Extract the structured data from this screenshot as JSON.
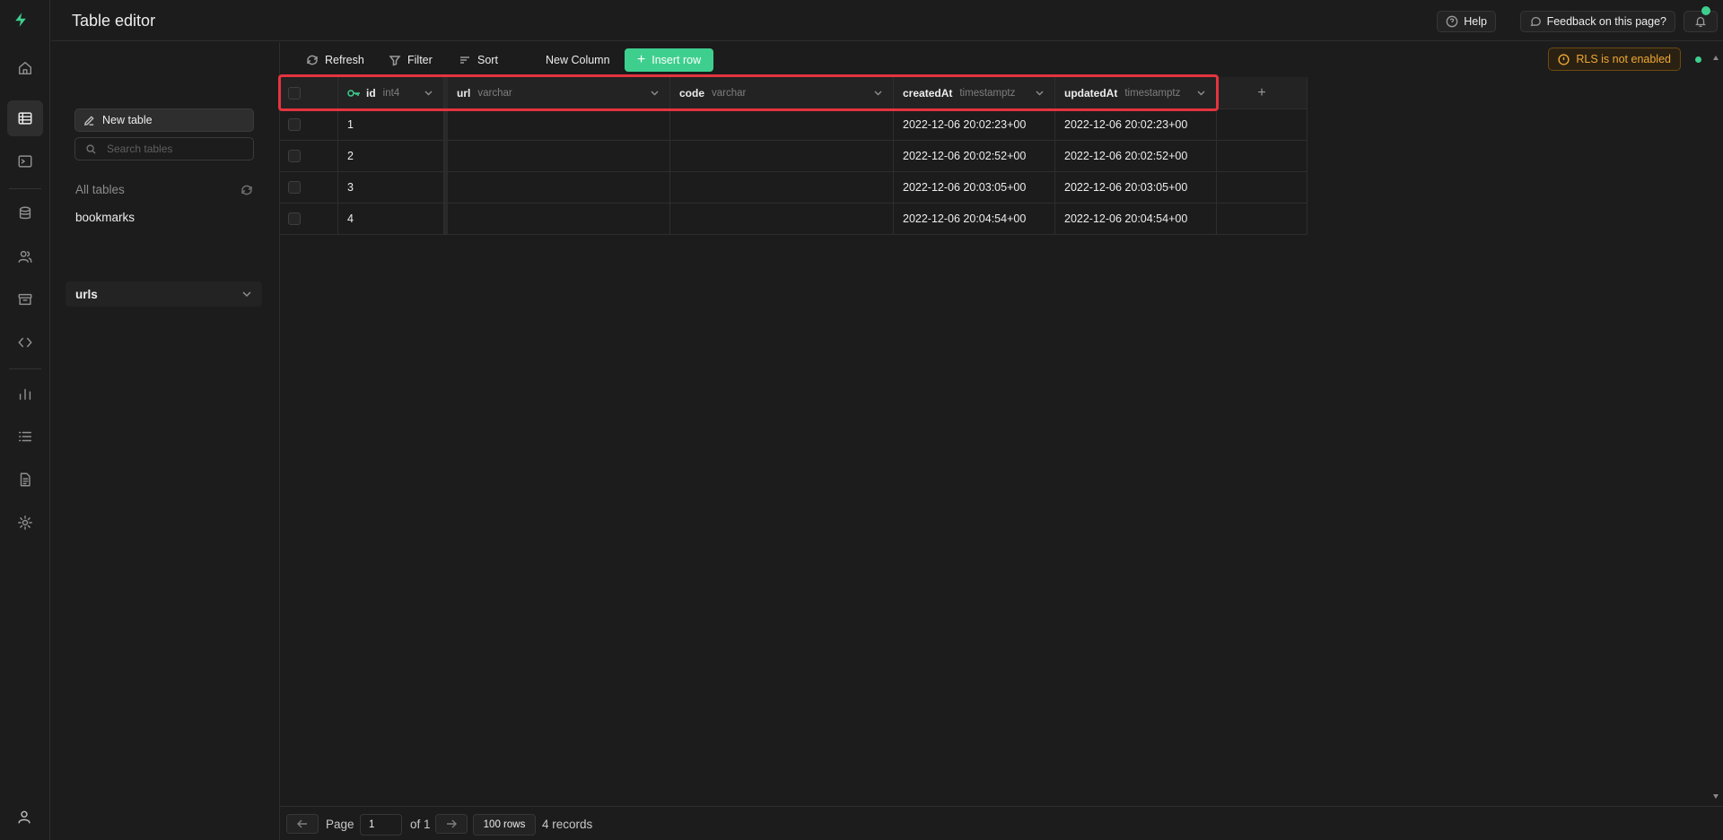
{
  "header": {
    "title": "Table editor",
    "help_label": "Help",
    "feedback_label": "Feedback on this page?"
  },
  "sidebar": {
    "new_table_label": "New table",
    "search_placeholder": "Search tables",
    "all_tables_label": "All tables",
    "tables": [
      "bookmarks"
    ],
    "schema_label": "urls"
  },
  "toolbar": {
    "refresh_label": "Refresh",
    "filter_label": "Filter",
    "sort_label": "Sort",
    "new_column_label": "New Column",
    "insert_row_label": "Insert row",
    "rls_label": "RLS is not enabled"
  },
  "grid": {
    "columns": [
      {
        "name": "id",
        "type": "int4"
      },
      {
        "name": "url",
        "type": "varchar"
      },
      {
        "name": "code",
        "type": "varchar"
      },
      {
        "name": "createdAt",
        "type": "timestamptz"
      },
      {
        "name": "updatedAt",
        "type": "timestamptz"
      }
    ],
    "rows": [
      {
        "id": "1",
        "url": "",
        "code": "",
        "createdAt": "2022-12-06 20:02:23+00",
        "updatedAt": "2022-12-06 20:02:23+00"
      },
      {
        "id": "2",
        "url": "",
        "code": "",
        "createdAt": "2022-12-06 20:02:52+00",
        "updatedAt": "2022-12-06 20:02:52+00"
      },
      {
        "id": "3",
        "url": "",
        "code": "",
        "createdAt": "2022-12-06 20:03:05+00",
        "updatedAt": "2022-12-06 20:03:05+00"
      },
      {
        "id": "4",
        "url": "",
        "code": "",
        "createdAt": "2022-12-06 20:04:54+00",
        "updatedAt": "2022-12-06 20:04:54+00"
      }
    ]
  },
  "footer": {
    "page_label": "Page",
    "page_value": "1",
    "of_label": "of 1",
    "rows_label": "100 rows",
    "records_label": "4 records"
  },
  "colors": {
    "accent": "#3ecf8e",
    "warning": "#f0a832",
    "highlight": "#e5343f"
  }
}
